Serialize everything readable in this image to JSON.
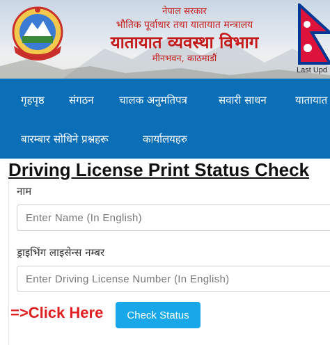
{
  "header": {
    "gov_name": "नेपाल सरकार",
    "ministry": "भौतिक पूर्वाधार तथा यातायात मन्त्रालय",
    "department": "यातायात व्यवस्था विभाग",
    "location": "मीनभवन, काठमाडौं",
    "last_updated": "Last Upd"
  },
  "nav": {
    "items": [
      {
        "label": "गृहपृष्ठ"
      },
      {
        "label": "संगठन"
      },
      {
        "label": "चालक अनुमतिपत्र"
      },
      {
        "label": "सवारी साधन"
      },
      {
        "label": "यातायात"
      },
      {
        "label": "बारम्बार सोधिने प्रश्नहरू"
      },
      {
        "label": "कार्यालयहरु"
      }
    ]
  },
  "main": {
    "title": "Driving License Print Status Check"
  },
  "form": {
    "name_label": "नाम",
    "name_placeholder": "Enter Name (In English)",
    "license_label": "ड्राइभिंग लाइसेन्स नम्बर",
    "license_placeholder": "Enter Driving License Number (In English)",
    "click_here": "=>Click Here",
    "submit_label": "Check Status"
  },
  "colors": {
    "nav_bg": "#0b6fb7",
    "header_text": "#c51a1a",
    "button_bg": "#18a8ea",
    "click_here": "#e02020"
  }
}
